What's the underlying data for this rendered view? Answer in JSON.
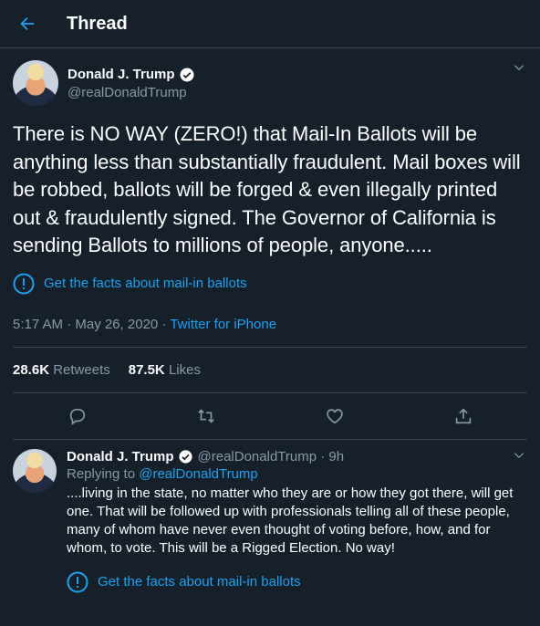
{
  "header": {
    "title": "Thread",
    "back_icon": "arrow-left-icon"
  },
  "colors": {
    "background": "#15202b",
    "accent": "#1da1f2",
    "muted": "#8899a6",
    "border": "#38444d"
  },
  "tweet": {
    "author_name": "Donald J. Trump",
    "author_handle": "@realDonaldTrump",
    "text": "There is NO WAY (ZERO!) that Mail-In Ballots will be anything less than substantially fraudulent. Mail boxes will be robbed, ballots will be forged & even illegally printed out & fraudulently signed. The Governor of California is sending Ballots to millions of people, anyone.....",
    "facts_label": "Get the facts about mail-in ballots",
    "time": "5:17 AM · May 26, 2020 · ",
    "source": "Twitter for iPhone",
    "retweets_count": "28.6K",
    "retweets_label": "Retweets",
    "likes_count": "87.5K",
    "likes_label": "Likes"
  },
  "reply": {
    "author_name": "Donald J. Trump",
    "author_handle": "@realDonaldTrump · 9h",
    "replying_prefix": "Replying to ",
    "replying_handle": "@realDonaldTrump",
    "text": "....living in the state, no matter who they are or how they got there, will get one. That will be followed up with professionals telling all of these people, many of whom have never even thought of voting before, how, and for whom, to vote. This will be a Rigged Election. No way!",
    "facts_label": "Get the facts about mail-in ballots"
  }
}
